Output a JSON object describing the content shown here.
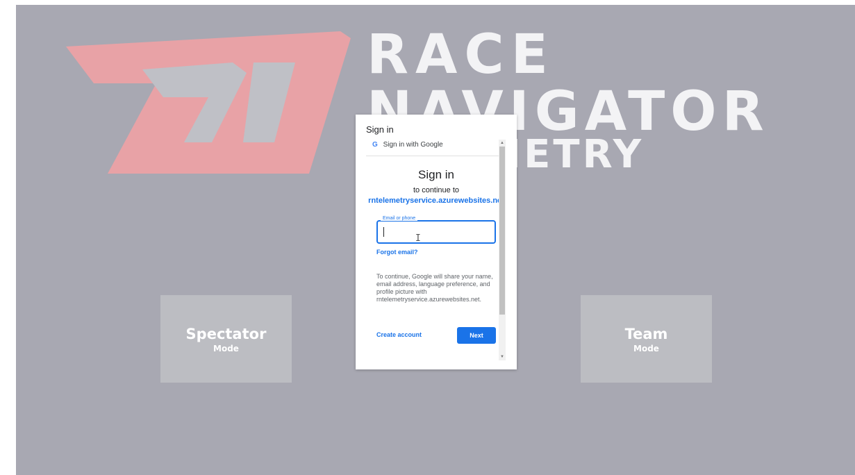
{
  "brand": {
    "line1": "RACE",
    "line2": "NAVIGATOR",
    "line3": "TELEMETRY",
    "logo_letters": "RN",
    "logo_color": "#e8a2a6",
    "text_color": "#f3f3f5",
    "background_color": "#a8a8b2"
  },
  "modes": {
    "spectator": {
      "title": "Spectator",
      "subtitle": "Mode"
    },
    "team": {
      "title": "Team",
      "subtitle": "Mode"
    }
  },
  "dialog": {
    "window_title": "Sign in",
    "google_bar_label": "Sign in with Google",
    "heading": "Sign in",
    "continue_text": "to continue to",
    "site": "rntelemetryservice.azurewebsites.net",
    "email_label": "Email or phone",
    "email_value": "",
    "forgot_email": "Forgot email?",
    "notice": "To continue, Google will share your name, email address, language preference, and profile picture with rntelemetryservice.azurewebsites.net.",
    "create_account": "Create account",
    "next": "Next",
    "accent_color": "#1a73e8"
  }
}
